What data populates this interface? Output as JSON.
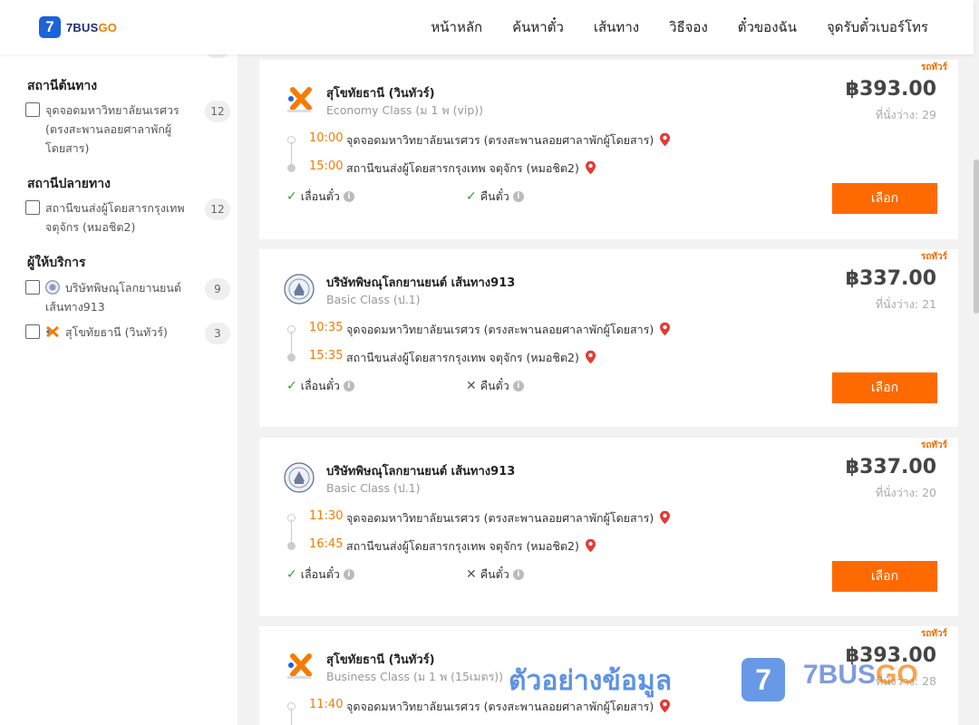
{
  "header": {
    "logo_mark": "7",
    "logo_text_a": "7BUS",
    "logo_text_b": "GO",
    "nav": [
      "หน้าหลัก",
      "ค้นหาตั๋ว",
      "เส้นทาง",
      "วิธีจอง",
      "ตั๋วของฉัน",
      "จุดรับตั๋วเบอร์โทร"
    ]
  },
  "sidebar": {
    "origin": {
      "title": "สถานีต้นทาง",
      "items": [
        {
          "label": "จุดจอดมหาวิทยาลัยนเรศวร (ตรงสะพานลอยศาลาพักผู้โดยสาร)",
          "count": "12"
        }
      ]
    },
    "destination": {
      "title": "สถานีปลายทาง",
      "items": [
        {
          "label": "สถานีขนส่งผู้โดยสารกรุงเทพ จตุจักร (หมอชิต2)",
          "count": "12"
        }
      ]
    },
    "operators": {
      "title": "ผู้ให้บริการ",
      "items": [
        {
          "label": "บริษัทพิษณุโลกยานยนต์ เส้นทาง913",
          "count": "9"
        },
        {
          "label": "สุโขทัยธานี (วินทัวร์)",
          "count": "3"
        }
      ]
    }
  },
  "cards": [
    {
      "tag": "รถทัวร์",
      "operator": "สุโขทัยธานี (วินทัวร์)",
      "class": "Economy Class (ม 1 พ (vip))",
      "price": "฿393.00",
      "seats": "ที่นั่งว่าง: 29",
      "depart_time": "10:00",
      "depart_stop": "จุดจอดมหาวิทยาลัยนเรศวร (ตรงสะพานลอยศาลาพักผู้โดยสาร)",
      "arrive_time": "15:00",
      "arrive_stop": "สถานีขนส่งผู้โดยสารกรุงเทพ จตุจักร (หมอชิต2)",
      "opt1": "เลื่อนตั๋ว",
      "opt1_ok": true,
      "opt2": "คืนตั๋ว",
      "opt2_ok": true,
      "button": "เลือก"
    },
    {
      "tag": "รถทัวร์",
      "operator": "บริษัทพิษณุโลกยานยนต์ เส้นทาง913",
      "class": "Basic Class (ป.1)",
      "price": "฿337.00",
      "seats": "ที่นั่งว่าง: 21",
      "depart_time": "10:35",
      "depart_stop": "จุดจอดมหาวิทยาลัยนเรศวร (ตรงสะพานลอยศาลาพักผู้โดยสาร)",
      "arrive_time": "15:35",
      "arrive_stop": "สถานีขนส่งผู้โดยสารกรุงเทพ จตุจักร (หมอชิต2)",
      "opt1": "เลื่อนตั๋ว",
      "opt1_ok": true,
      "opt2": "คืนตั๋ว",
      "opt2_ok": false,
      "button": "เลือก"
    },
    {
      "tag": "รถทัวร์",
      "operator": "บริษัทพิษณุโลกยานยนต์ เส้นทาง913",
      "class": "Basic Class (ป.1)",
      "price": "฿337.00",
      "seats": "ที่นั่งว่าง: 20",
      "depart_time": "11:30",
      "depart_stop": "จุดจอดมหาวิทยาลัยนเรศวร (ตรงสะพานลอยศาลาพักผู้โดยสาร)",
      "arrive_time": "16:45",
      "arrive_stop": "สถานีขนส่งผู้โดยสารกรุงเทพ จตุจักร (หมอชิต2)",
      "opt1": "เลื่อนตั๋ว",
      "opt1_ok": true,
      "opt2": "คืนตั๋ว",
      "opt2_ok": false,
      "button": "เลือก"
    },
    {
      "tag": "รถทัวร์",
      "operator": "สุโขทัยธานี (วินทัวร์)",
      "class": "Business Class (ม 1 พ (15เมตร))",
      "price": "฿393.00",
      "seats": "ที่นั่งว่าง: 28",
      "depart_time": "11:40",
      "depart_stop": "จุดจอดมหาวิทยาลัยนเรศวร (ตรงสะพานลอยศาลาพักผู้โดยสาร)"
    }
  ],
  "watermark": {
    "text": "ตัวอย่างข้อมูล",
    "logo_mark": "7",
    "brand_a": "7BUS",
    "brand_b": "GO"
  },
  "colors": {
    "accent": "#ff6a00",
    "time": "#f57c00",
    "brand_blue": "#1c62d8",
    "ok_green": "#2e9e3a"
  }
}
